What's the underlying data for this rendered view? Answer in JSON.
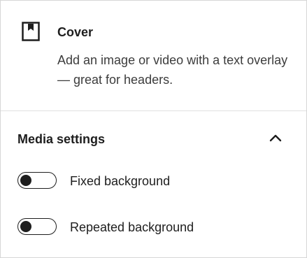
{
  "block": {
    "icon": "cover-block-icon",
    "title": "Cover",
    "description": "Add an image or video with a text overlay — great for headers."
  },
  "media_settings": {
    "title": "Media settings",
    "expanded": true,
    "collapse_icon": "chevron-up-icon",
    "toggles": [
      {
        "label": "Fixed background",
        "checked": false
      },
      {
        "label": "Repeated background",
        "checked": false
      }
    ]
  },
  "colors": {
    "text": "#1e1e1e",
    "secondary_text": "#3c3c3c",
    "divider": "#e0e0e0",
    "border": "#d6d6d6"
  }
}
